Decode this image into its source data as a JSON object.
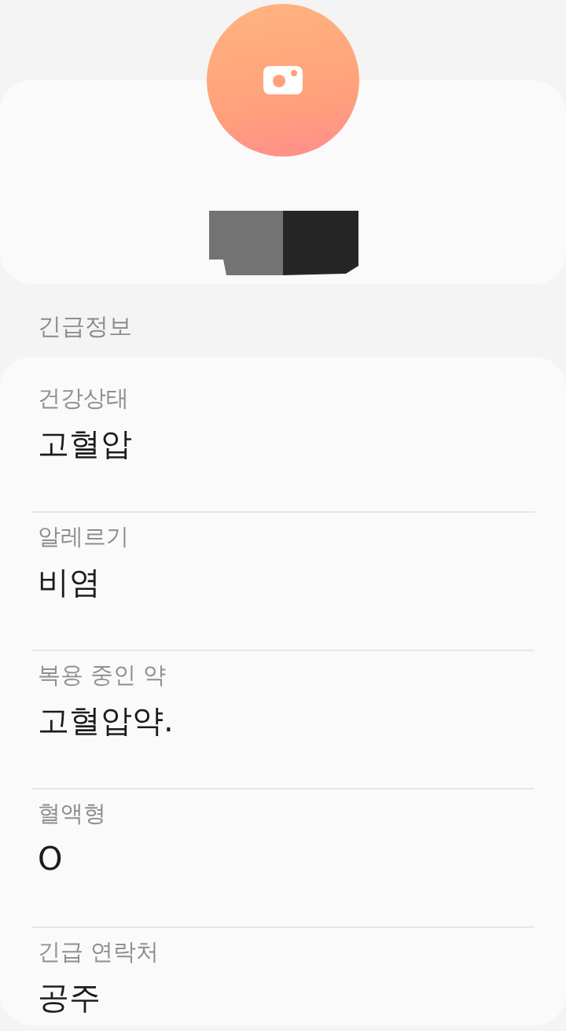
{
  "section_title": "긴급정보",
  "fields": [
    {
      "label": "건강상태",
      "value": "고혈압"
    },
    {
      "label": "알레르기",
      "value": "비염"
    },
    {
      "label": "복용 중인 약",
      "value": "고혈압약."
    },
    {
      "label": "혈액형",
      "value": "O"
    },
    {
      "label": "긴급 연락처",
      "value": "공주"
    }
  ]
}
